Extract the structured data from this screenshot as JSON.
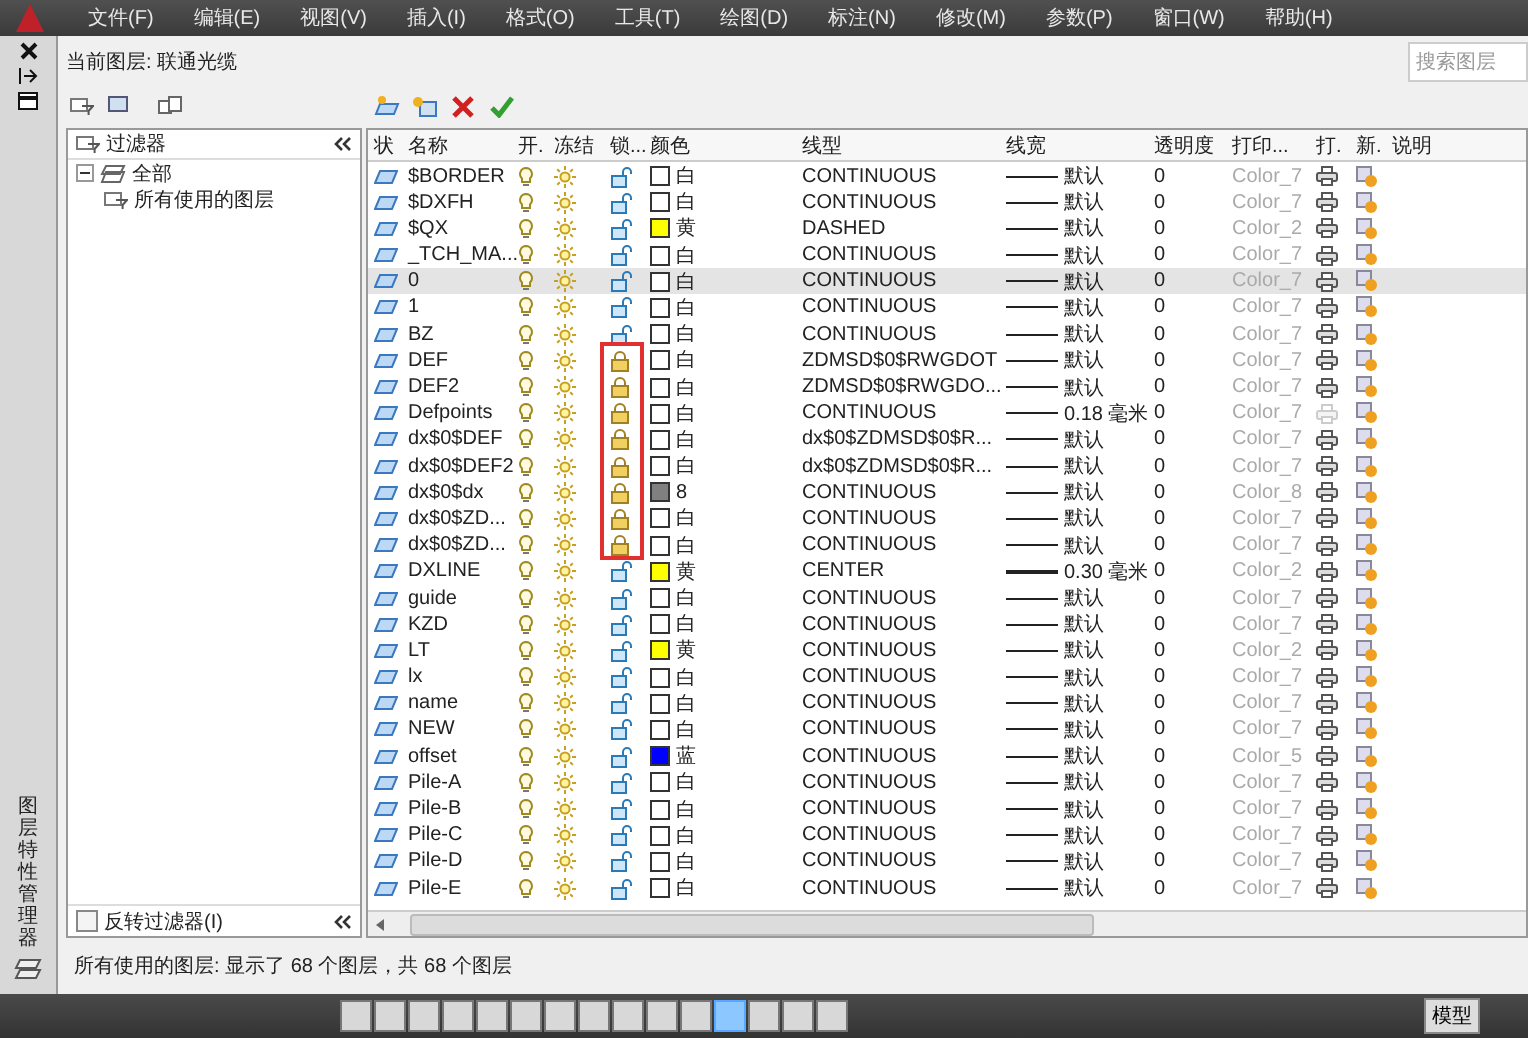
{
  "menu": [
    "文件(F)",
    "编辑(E)",
    "视图(V)",
    "插入(I)",
    "格式(O)",
    "工具(T)",
    "绘图(D)",
    "标注(N)",
    "修改(M)",
    "参数(P)",
    "窗口(W)",
    "帮助(H)"
  ],
  "palette_title": "图层特性管理器",
  "current_layer": "当前图层: 联通光缆",
  "search": {
    "placeholder": "搜索图层"
  },
  "filters": {
    "title": "过滤器",
    "tree": [
      {
        "label": "全部",
        "expanded": true,
        "children": [
          {
            "label": "所有使用的图层"
          }
        ]
      }
    ],
    "invert": {
      "label": "反转过滤器(I)",
      "checked": false
    }
  },
  "table": {
    "columns": [
      "状",
      "名称",
      "开.",
      "冻结",
      "锁...",
      "颜色",
      "线型",
      "线宽",
      "透明度",
      "打印...",
      "打.",
      "新.",
      "说明"
    ],
    "rows": [
      {
        "name": "$BORDER",
        "locked": false,
        "color": "#ffffff",
        "color_label": "白",
        "linetype": "CONTINUOUS",
        "lineweight": "默认",
        "heavy": false,
        "transparency": "0",
        "plot_style": "Color_7",
        "plot": true,
        "selected": false
      },
      {
        "name": "$DXFH",
        "locked": false,
        "color": "#ffffff",
        "color_label": "白",
        "linetype": "CONTINUOUS",
        "lineweight": "默认",
        "heavy": false,
        "transparency": "0",
        "plot_style": "Color_7",
        "plot": true,
        "selected": false
      },
      {
        "name": "$QX",
        "locked": false,
        "color": "#ffff00",
        "color_label": "黄",
        "linetype": "DASHED",
        "lineweight": "默认",
        "heavy": false,
        "transparency": "0",
        "plot_style": "Color_2",
        "plot": true,
        "selected": false
      },
      {
        "name": "_TCH_MA...",
        "locked": false,
        "color": "#ffffff",
        "color_label": "白",
        "linetype": "CONTINUOUS",
        "lineweight": "默认",
        "heavy": false,
        "transparency": "0",
        "plot_style": "Color_7",
        "plot": true,
        "selected": false
      },
      {
        "name": "0",
        "locked": false,
        "color": "#ffffff",
        "color_label": "白",
        "linetype": "CONTINUOUS",
        "lineweight": "默认",
        "heavy": false,
        "transparency": "0",
        "plot_style": "Color_7",
        "plot": true,
        "selected": true
      },
      {
        "name": "1",
        "locked": false,
        "color": "#ffffff",
        "color_label": "白",
        "linetype": "CONTINUOUS",
        "lineweight": "默认",
        "heavy": false,
        "transparency": "0",
        "plot_style": "Color_7",
        "plot": true,
        "selected": false
      },
      {
        "name": "BZ",
        "locked": false,
        "color": "#ffffff",
        "color_label": "白",
        "linetype": "CONTINUOUS",
        "lineweight": "默认",
        "heavy": false,
        "transparency": "0",
        "plot_style": "Color_7",
        "plot": true,
        "selected": false
      },
      {
        "name": "DEF",
        "locked": true,
        "color": "#ffffff",
        "color_label": "白",
        "linetype": "ZDMSD$0$RWGDOT",
        "lineweight": "默认",
        "heavy": false,
        "transparency": "0",
        "plot_style": "Color_7",
        "plot": true,
        "selected": false
      },
      {
        "name": "DEF2",
        "locked": true,
        "color": "#ffffff",
        "color_label": "白",
        "linetype": "ZDMSD$0$RWGDO...",
        "lineweight": "默认",
        "heavy": false,
        "transparency": "0",
        "plot_style": "Color_7",
        "plot": true,
        "selected": false
      },
      {
        "name": "Defpoints",
        "locked": true,
        "color": "#ffffff",
        "color_label": "白",
        "linetype": "CONTINUOUS",
        "lineweight": "0.18 毫米",
        "heavy": false,
        "transparency": "0",
        "plot_style": "Color_7",
        "plot": false,
        "selected": false
      },
      {
        "name": "dx$0$DEF",
        "locked": true,
        "color": "#ffffff",
        "color_label": "白",
        "linetype": "dx$0$ZDMSD$0$R...",
        "lineweight": "默认",
        "heavy": false,
        "transparency": "0",
        "plot_style": "Color_7",
        "plot": true,
        "selected": false
      },
      {
        "name": "dx$0$DEF2",
        "locked": true,
        "color": "#ffffff",
        "color_label": "白",
        "linetype": "dx$0$ZDMSD$0$R...",
        "lineweight": "默认",
        "heavy": false,
        "transparency": "0",
        "plot_style": "Color_7",
        "plot": true,
        "selected": false
      },
      {
        "name": "dx$0$dx",
        "locked": true,
        "color": "#808080",
        "color_label": "8",
        "linetype": "CONTINUOUS",
        "lineweight": "默认",
        "heavy": false,
        "transparency": "0",
        "plot_style": "Color_8",
        "plot": true,
        "selected": false
      },
      {
        "name": "dx$0$ZD...",
        "locked": true,
        "color": "#ffffff",
        "color_label": "白",
        "linetype": "CONTINUOUS",
        "lineweight": "默认",
        "heavy": false,
        "transparency": "0",
        "plot_style": "Color_7",
        "plot": true,
        "selected": false
      },
      {
        "name": "dx$0$ZD...",
        "locked": true,
        "color": "#ffffff",
        "color_label": "白",
        "linetype": "CONTINUOUS",
        "lineweight": "默认",
        "heavy": false,
        "transparency": "0",
        "plot_style": "Color_7",
        "plot": true,
        "selected": false
      },
      {
        "name": "DXLINE",
        "locked": false,
        "color": "#ffff00",
        "color_label": "黄",
        "linetype": "CENTER",
        "lineweight": "0.30 毫米",
        "heavy": true,
        "transparency": "0",
        "plot_style": "Color_2",
        "plot": true,
        "selected": false
      },
      {
        "name": "guide",
        "locked": false,
        "color": "#ffffff",
        "color_label": "白",
        "linetype": "CONTINUOUS",
        "lineweight": "默认",
        "heavy": false,
        "transparency": "0",
        "plot_style": "Color_7",
        "plot": true,
        "selected": false
      },
      {
        "name": "KZD",
        "locked": false,
        "color": "#ffffff",
        "color_label": "白",
        "linetype": "CONTINUOUS",
        "lineweight": "默认",
        "heavy": false,
        "transparency": "0",
        "plot_style": "Color_7",
        "plot": true,
        "selected": false
      },
      {
        "name": "LT",
        "locked": false,
        "color": "#ffff00",
        "color_label": "黄",
        "linetype": "CONTINUOUS",
        "lineweight": "默认",
        "heavy": false,
        "transparency": "0",
        "plot_style": "Color_2",
        "plot": true,
        "selected": false
      },
      {
        "name": "lx",
        "locked": false,
        "color": "#ffffff",
        "color_label": "白",
        "linetype": "CONTINUOUS",
        "lineweight": "默认",
        "heavy": false,
        "transparency": "0",
        "plot_style": "Color_7",
        "plot": true,
        "selected": false
      },
      {
        "name": "name",
        "locked": false,
        "color": "#ffffff",
        "color_label": "白",
        "linetype": "CONTINUOUS",
        "lineweight": "默认",
        "heavy": false,
        "transparency": "0",
        "plot_style": "Color_7",
        "plot": true,
        "selected": false
      },
      {
        "name": "NEW",
        "locked": false,
        "color": "#ffffff",
        "color_label": "白",
        "linetype": "CONTINUOUS",
        "lineweight": "默认",
        "heavy": false,
        "transparency": "0",
        "plot_style": "Color_7",
        "plot": true,
        "selected": false
      },
      {
        "name": "offset",
        "locked": false,
        "color": "#0000ff",
        "color_label": "蓝",
        "linetype": "CONTINUOUS",
        "lineweight": "默认",
        "heavy": false,
        "transparency": "0",
        "plot_style": "Color_5",
        "plot": true,
        "selected": false
      },
      {
        "name": "Pile-A",
        "locked": false,
        "color": "#ffffff",
        "color_label": "白",
        "linetype": "CONTINUOUS",
        "lineweight": "默认",
        "heavy": false,
        "transparency": "0",
        "plot_style": "Color_7",
        "plot": true,
        "selected": false
      },
      {
        "name": "Pile-B",
        "locked": false,
        "color": "#ffffff",
        "color_label": "白",
        "linetype": "CONTINUOUS",
        "lineweight": "默认",
        "heavy": false,
        "transparency": "0",
        "plot_style": "Color_7",
        "plot": true,
        "selected": false
      },
      {
        "name": "Pile-C",
        "locked": false,
        "color": "#ffffff",
        "color_label": "白",
        "linetype": "CONTINUOUS",
        "lineweight": "默认",
        "heavy": false,
        "transparency": "0",
        "plot_style": "Color_7",
        "plot": true,
        "selected": false
      },
      {
        "name": "Pile-D",
        "locked": false,
        "color": "#ffffff",
        "color_label": "白",
        "linetype": "CONTINUOUS",
        "lineweight": "默认",
        "heavy": false,
        "transparency": "0",
        "plot_style": "Color_7",
        "plot": true,
        "selected": false
      },
      {
        "name": "Pile-E",
        "locked": false,
        "color": "#ffffff",
        "color_label": "白",
        "linetype": "CONTINUOUS",
        "lineweight": "默认",
        "heavy": false,
        "transparency": "0",
        "plot_style": "Color_7",
        "plot": true,
        "selected": false
      }
    ]
  },
  "status": "所有使用的图层: 显示了 68 个图层，共 68 个图层",
  "status_toggles": [
    {
      "on": false
    },
    {
      "on": false
    },
    {
      "on": false
    },
    {
      "on": false
    },
    {
      "on": false
    },
    {
      "on": false
    },
    {
      "on": false
    },
    {
      "on": false
    },
    {
      "on": false
    },
    {
      "on": false
    },
    {
      "on": false
    },
    {
      "on": true
    },
    {
      "on": false
    },
    {
      "on": false
    },
    {
      "on": false
    }
  ],
  "model_button": "模型"
}
